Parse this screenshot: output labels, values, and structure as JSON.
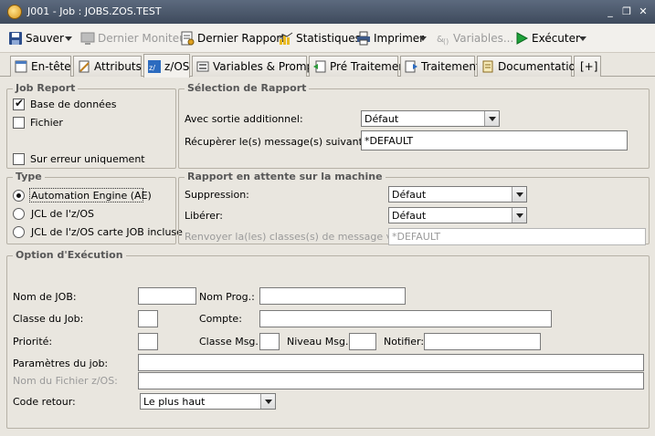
{
  "window": {
    "title": "J001 - Job : JOBS.ZOS.TEST",
    "min": "_",
    "restore": "❐",
    "close": "✕"
  },
  "toolbar": {
    "save": "Sauver",
    "last_monitor": "Dernier Moniteur",
    "last_report": "Dernier Rapport",
    "statistics": "Statistiques",
    "print": "Imprimer",
    "variables": "Variables...",
    "execute": "Exécuter"
  },
  "tabs": [
    "En-tête",
    "Attributs",
    "z/OS",
    "Variables & Prompts",
    "Pré Traitement",
    "Traitement",
    "Documentation",
    "[+]"
  ],
  "active_tab": "z/OS",
  "job_report": {
    "title": "Job Report",
    "database": "Base de données",
    "file": "Fichier",
    "on_error_only": "Sur erreur uniquement"
  },
  "report_selection": {
    "title": "Sélection de Rapport",
    "extra_output_label": "Avec sortie additionnel:",
    "extra_output_value": "Défaut",
    "retrieve_label": "Récupèrer le(s) message(s) suivant(s):",
    "retrieve_value": "*DEFAULT"
  },
  "type": {
    "title": "Type",
    "options": [
      "Automation Engine (AE)",
      "JCL de l'z/OS",
      "JCL de l'z/OS carte JOB incluse"
    ],
    "selected": 0
  },
  "held_report": {
    "title": "Rapport en attente sur la machine",
    "deletion_label": "Suppression:",
    "deletion_value": "Défaut",
    "release_label": "Libérer:",
    "release_value": "Défaut",
    "resend_label": "Renvoyer la(les) classes(s) de message vers:",
    "resend_value": "*DEFAULT"
  },
  "execution": {
    "title": "Option d'Exécution",
    "job_name": "Nom de JOB:",
    "prog_name": "Nom Prog.:",
    "job_class": "Classe du Job:",
    "account": "Compte:",
    "priority": "Priorité:",
    "msg_class": "Classe Msg.:",
    "msg_level": "Niveau Msg.:",
    "notify": "Notifier:",
    "job_params": "Paramètres du job:",
    "zos_file": "Nom du Fichier z/OS:",
    "return_code": "Code retour:",
    "return_code_value": "Le plus haut"
  }
}
